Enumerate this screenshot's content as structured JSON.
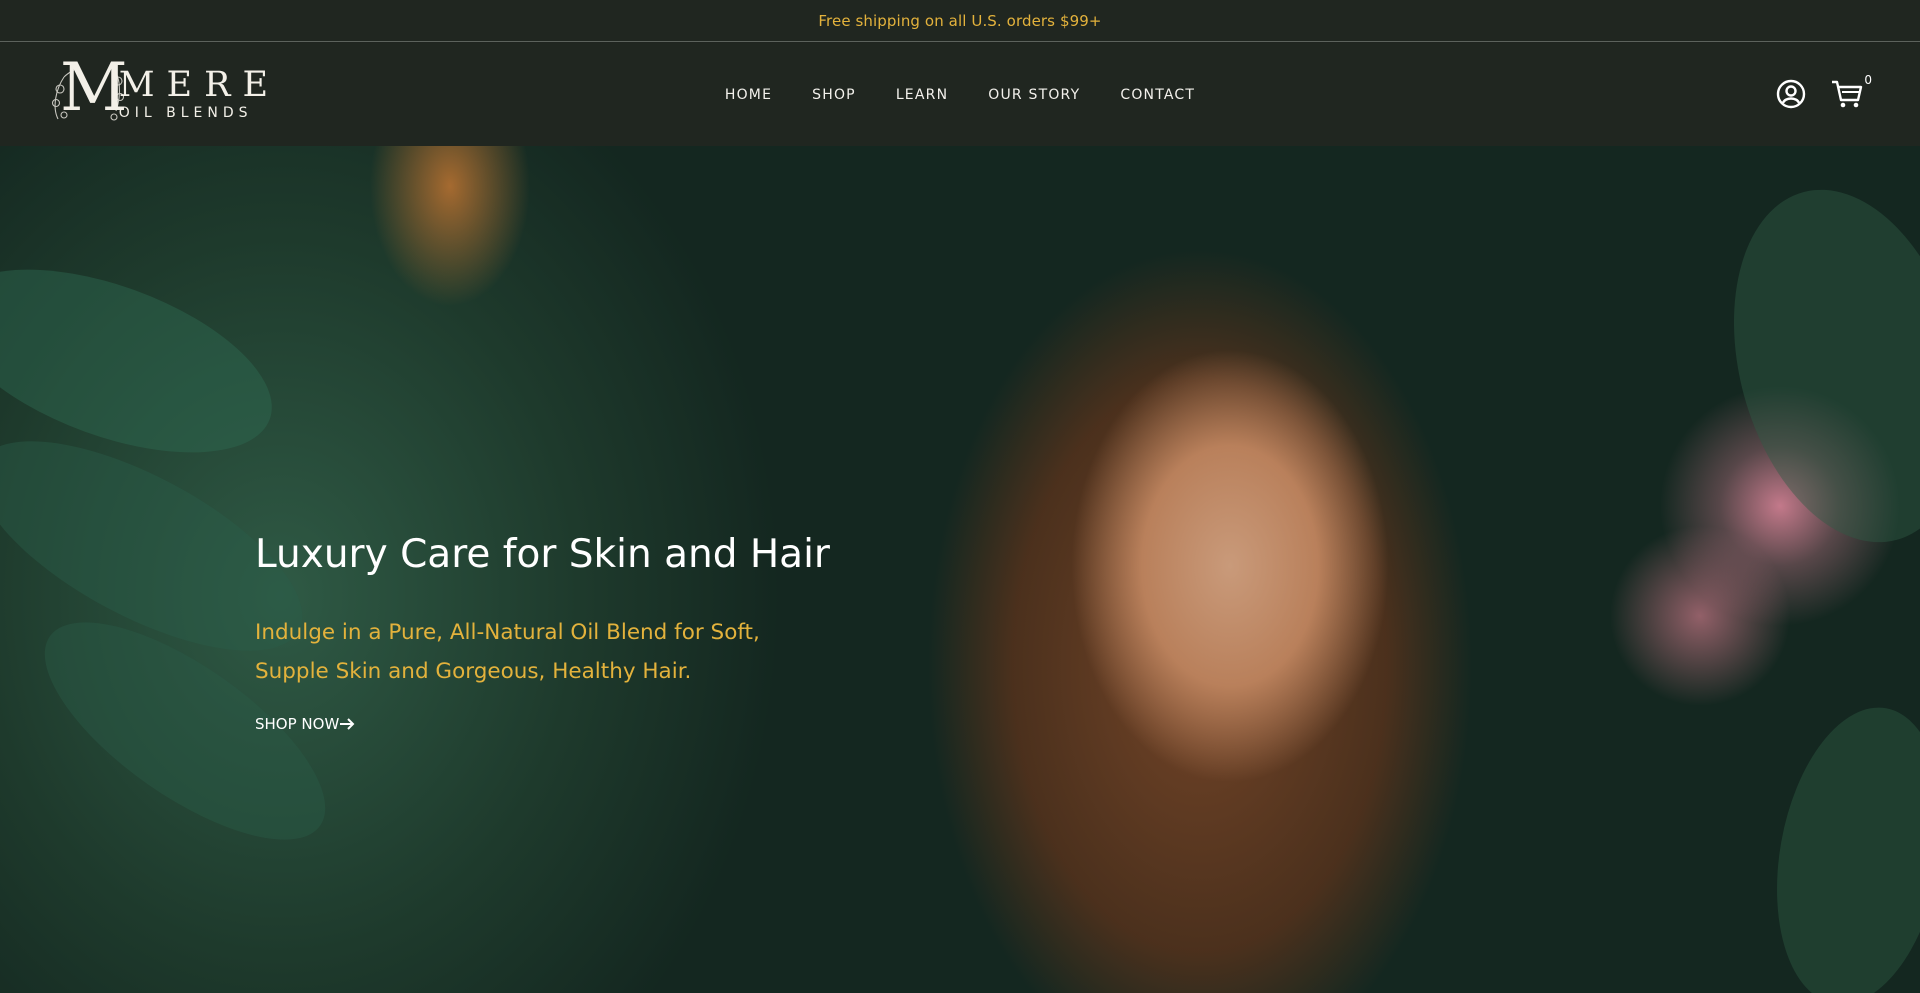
{
  "announcement": {
    "text": "Free shipping on all U.S. orders $99+"
  },
  "header": {
    "logo": {
      "mark": "M",
      "line1": "MERE",
      "line2": "OIL BLENDS"
    },
    "nav": [
      {
        "label": "HOME"
      },
      {
        "label": "SHOP"
      },
      {
        "label": "LEARN"
      },
      {
        "label": "OUR STORY"
      },
      {
        "label": "CONTACT"
      }
    ],
    "account_icon": "user-circle-icon",
    "cart_icon": "shopping-cart-icon",
    "cart_count": "0"
  },
  "hero": {
    "title": "Luxury Care for Skin and Hair",
    "subtitle": "Indulge in a Pure, All-Natural Oil Blend for Soft, Supple Skin and Gorgeous, Healthy Hair.",
    "cta_label": "SHOP NOW"
  },
  "colors": {
    "accent": "#e3b23c",
    "header_bg": "#202620",
    "text_light": "#ffffff"
  }
}
